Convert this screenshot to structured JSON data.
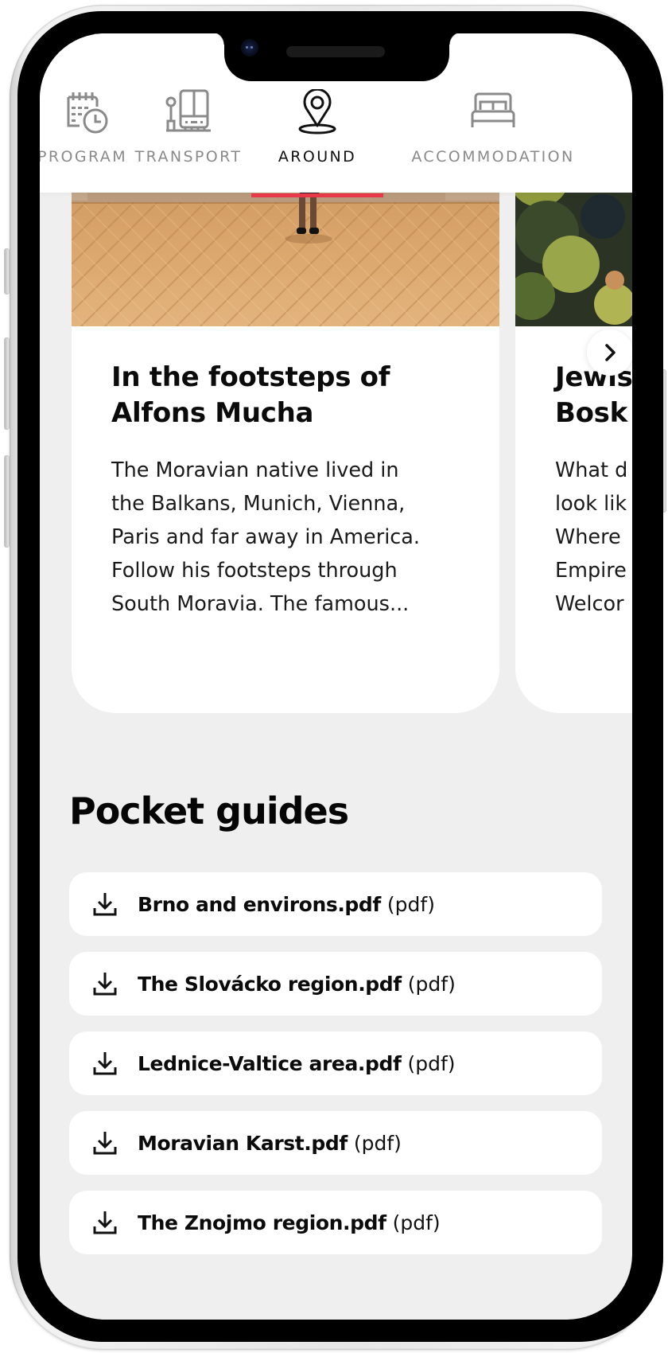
{
  "tabs": [
    {
      "label": "PROGRAM",
      "icon": "calendar-clock-icon",
      "active": false
    },
    {
      "label": "TRANSPORT",
      "icon": "bus-stop-icon",
      "active": false
    },
    {
      "label": "AROUND",
      "icon": "map-pin-icon",
      "active": true
    },
    {
      "label": "ACCOMMODATION",
      "icon": "bed-icon",
      "active": false
    }
  ],
  "colors": {
    "accent": "#e8394a",
    "tab_inactive": "#8a8a8a",
    "tab_active": "#111111",
    "page_background": "#efefef",
    "card_background": "#ffffff"
  },
  "cards": [
    {
      "title": "In the footsteps of\nAlfons Mucha",
      "title_line1": "In the footsteps of",
      "title_line2": "Alfons Mucha",
      "text": "The Moravian native lived in\nthe Balkans, Munich, Vienna,\nParis and far away in America.\nFollow his footsteps through\nSouth Moravia. The famous...",
      "image": "gallery-hall-parquet-floor-photo"
    },
    {
      "title_line1": "Jewis",
      "title_line2": "Bosk",
      "text": "What d\nlook lik\nWhere\nEmpire\nWelcor",
      "image": "forest-treetops-photo"
    }
  ],
  "carousel": {
    "next_icon": "chevron-right-icon"
  },
  "pocket_guides": {
    "title": "Pocket guides",
    "items": [
      {
        "name": "Brno and environs.pdf",
        "ext": "(pdf)",
        "icon": "download-icon"
      },
      {
        "name": "The Slovácko region.pdf",
        "ext": "(pdf)",
        "icon": "download-icon"
      },
      {
        "name": "Lednice-Valtice area.pdf",
        "ext": "(pdf)",
        "icon": "download-icon"
      },
      {
        "name": "Moravian Karst.pdf",
        "ext": "(pdf)",
        "icon": "download-icon"
      },
      {
        "name": "The Znojmo region.pdf",
        "ext": "(pdf)",
        "icon": "download-icon"
      }
    ]
  }
}
